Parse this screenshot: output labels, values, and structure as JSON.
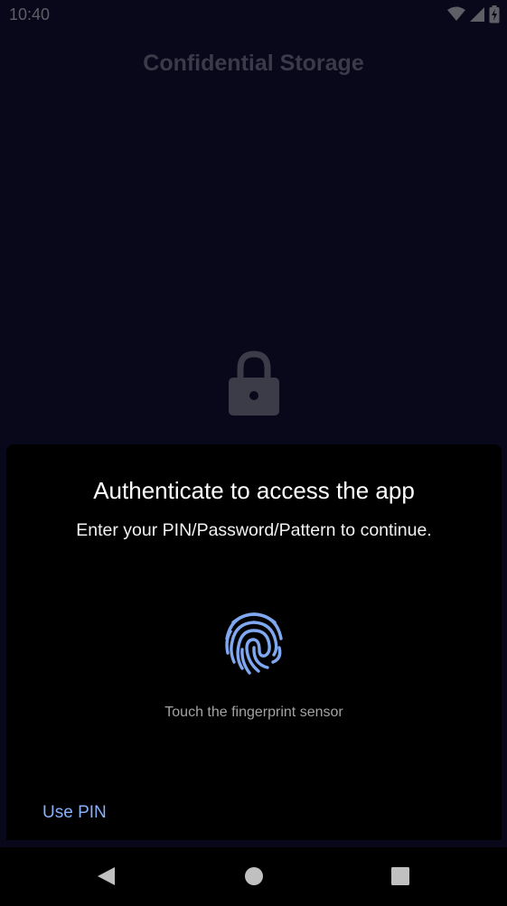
{
  "status_bar": {
    "time": "10:40",
    "icons": [
      "wifi-icon",
      "signal-icon",
      "battery-charging-icon"
    ]
  },
  "app": {
    "title": "Confidential Storage",
    "center_icon": "lock-icon"
  },
  "auth_sheet": {
    "title": "Authenticate to access the app",
    "subtitle": "Enter your PIN/Password/Pattern to continue.",
    "icon": "fingerprint-icon",
    "hint": "Touch the fingerprint sensor",
    "use_pin_label": "Use PIN"
  },
  "nav_bar": {
    "buttons": [
      "back-icon",
      "home-icon",
      "recents-icon"
    ]
  },
  "colors": {
    "background": "#08081a",
    "sheet": "#000000",
    "accent": "#8ab0f8",
    "fingerprint": "#7fa8f0"
  }
}
